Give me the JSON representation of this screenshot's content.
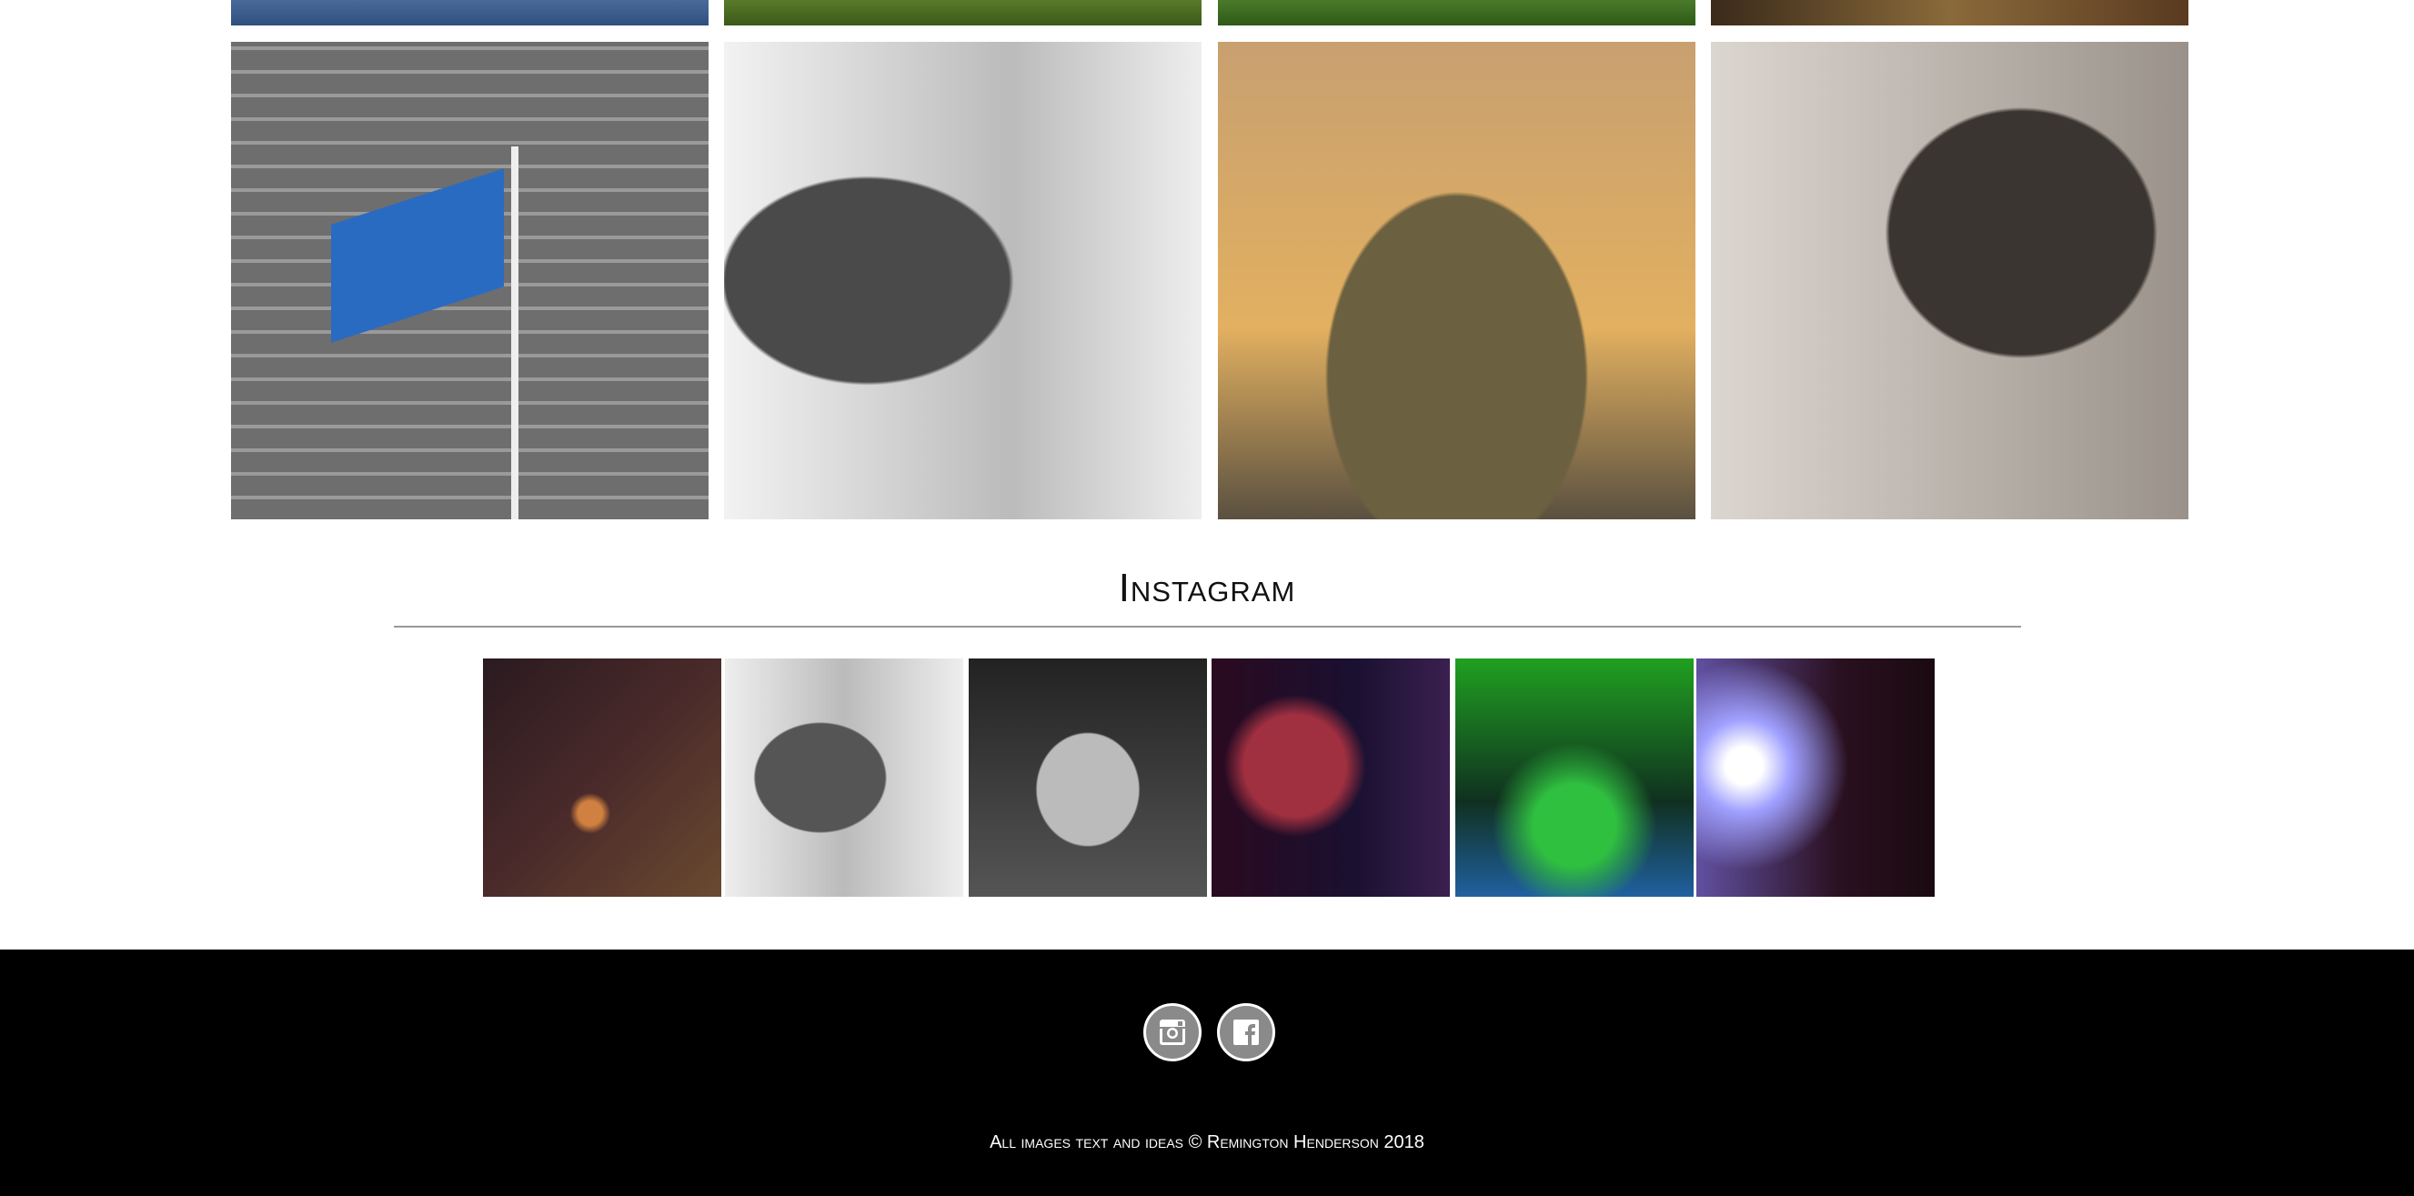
{
  "gallery": {
    "rows": [
      {
        "tiles": [
          "photo",
          "photo",
          "photo",
          "photo"
        ]
      },
      {
        "tiles": [
          "flag-photo",
          "soldier-bw-photo",
          "soldier-portrait-photo",
          "man-profile-photo"
        ]
      }
    ]
  },
  "instagram": {
    "heading": "Instagram",
    "images": [
      "candle-photo",
      "soldier-bw-photo",
      "seated-man-photo",
      "singer-photo",
      "mixer-photo",
      "backlit-man-photo"
    ]
  },
  "footer": {
    "social": [
      {
        "icon": "instagram-icon"
      },
      {
        "icon": "facebook-icon"
      }
    ],
    "copyright": "All images text and ideas © Remington Henderson 2018"
  },
  "colors": {
    "footer_bg": "#000000",
    "social_bg": "#8a8a8a"
  }
}
